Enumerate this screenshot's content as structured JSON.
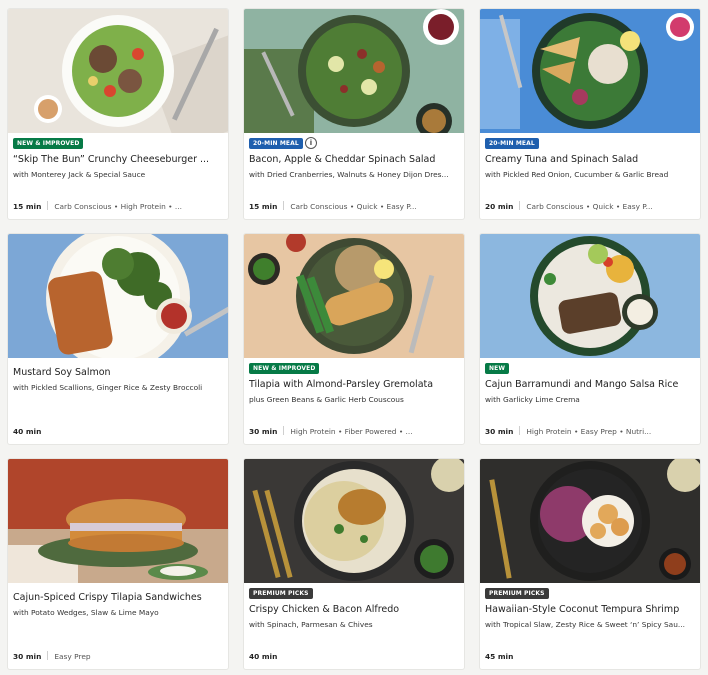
{
  "recipes": [
    {
      "badge": "NEW & IMPROVED",
      "badge_color": "#067a46",
      "title": "“Skip The Bun” Crunchy Cheeseburger ...",
      "subtitle": "with Monterey Jack & Special Sauce",
      "time": "15 min",
      "tags": "Carb Conscious • High Protein • ..."
    },
    {
      "badge": "20-MIN MEAL",
      "badge_color": "#1f5fae",
      "info_icon": "info-icon",
      "title": "Bacon, Apple & Cheddar Spinach Salad",
      "subtitle": "with Dried Cranberries, Walnuts & Honey Dijon Dres...",
      "time": "15 min",
      "tags": "Carb Conscious • Quick • Easy P..."
    },
    {
      "badge": "20-MIN MEAL",
      "badge_color": "#1f5fae",
      "title": "Creamy Tuna and Spinach Salad",
      "subtitle": "with Pickled Red Onion, Cucumber & Garlic Bread",
      "time": "20 min",
      "tags": "Carb Conscious • Quick • Easy P..."
    },
    {
      "badge": "",
      "title": "Mustard Soy Salmon",
      "subtitle": "with Pickled Scallions, Ginger Rice & Zesty Broccoli",
      "time": "40 min",
      "tags": ""
    },
    {
      "badge": "NEW & IMPROVED",
      "badge_color": "#067a46",
      "title": "Tilapia with Almond-Parsley Gremolata",
      "subtitle": "plus Green Beans & Garlic Herb Couscous",
      "time": "30 min",
      "tags": "High Protein • Fiber Powered • ..."
    },
    {
      "badge": "NEW",
      "badge_color": "#067a46",
      "title": "Cajun Barramundi and Mango Salsa Rice",
      "subtitle": "with Garlicky Lime Crema",
      "time": "30 min",
      "tags": "High Protein • Easy Prep • Nutri..."
    },
    {
      "badge": "",
      "title": "Cajun-Spiced Crispy Tilapia Sandwiches",
      "subtitle": "with Potato Wedges, Slaw & Lime Mayo",
      "time": "30 min",
      "tags": "Easy Prep"
    },
    {
      "badge": "PREMIUM PICKS",
      "badge_color": "#3a3a3a",
      "title": "Crispy Chicken & Bacon Alfredo",
      "subtitle": "with Spinach, Parmesan & Chives",
      "time": "40 min",
      "tags": ""
    },
    {
      "badge": "PREMIUM PICKS",
      "badge_color": "#3a3a3a",
      "title": "Hawaiian-Style Coconut Tempura Shrimp",
      "subtitle": "with Tropical Slaw, Zesty Rice & Sweet ‘n’ Spicy Sau...",
      "time": "45 min",
      "tags": ""
    }
  ],
  "info_icon_glyph": "i"
}
